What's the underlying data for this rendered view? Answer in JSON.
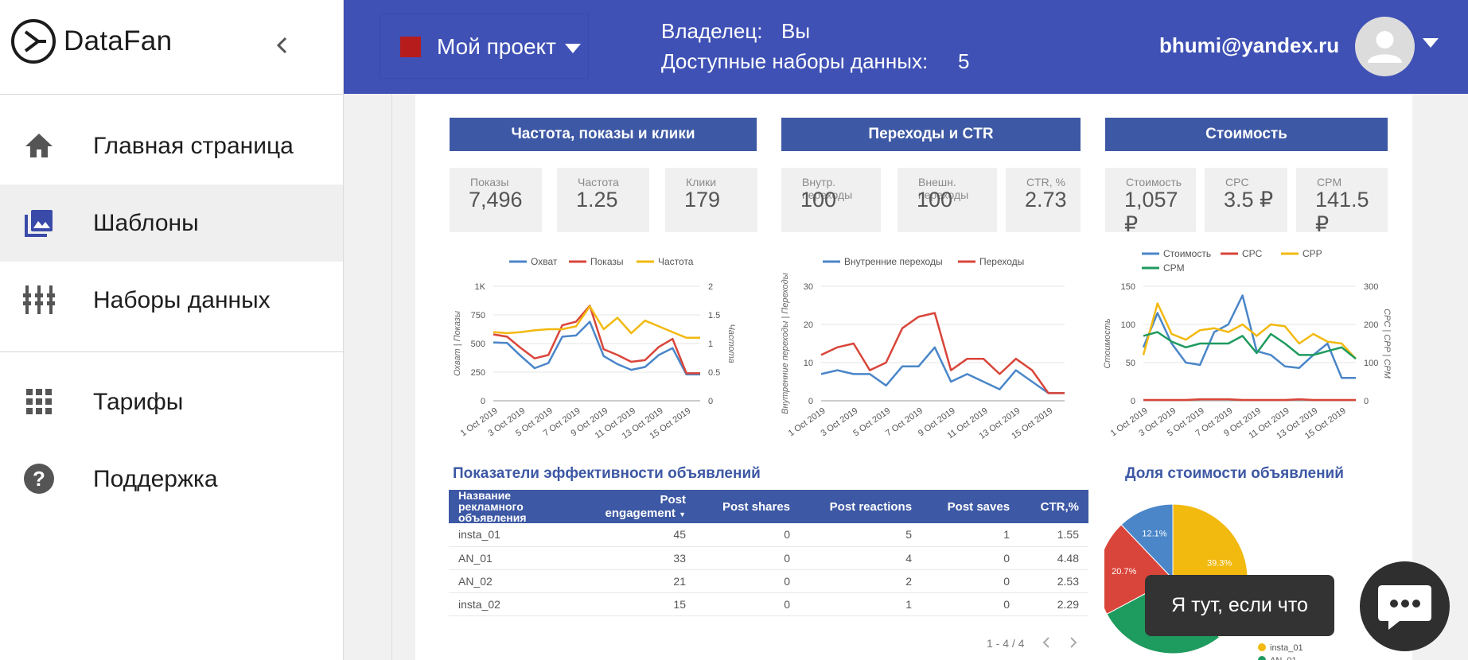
{
  "app": {
    "name": "DataFan"
  },
  "sidebar": {
    "items": [
      {
        "label": "Главная страница",
        "icon": "home-icon"
      },
      {
        "label": "Шаблоны",
        "icon": "templates-icon",
        "active": true
      },
      {
        "label": "Наборы данных",
        "icon": "datasets-icon"
      },
      {
        "label": "Тарифы",
        "icon": "grid-icon"
      },
      {
        "label": "Поддержка",
        "icon": "help-icon"
      }
    ]
  },
  "topbar": {
    "project_name": "Мой проект",
    "project_color": "#b71c1c",
    "owner_label": "Владелец:",
    "owner_value": "Вы",
    "datasets_label": "Доступные наборы данных:",
    "datasets_value": "5",
    "email": "bhumi@yandex.ru"
  },
  "colors": {
    "header": "#3f51b5",
    "accent": "#3d58a4",
    "blue": "#4a86c8",
    "red": "#d9453a",
    "yellow": "#f2b90f",
    "green": "#1e9b5e"
  },
  "sections": {
    "freq": "Частота, показы и клики",
    "clicks": "Переходы и CTR",
    "cost": "Стоимость"
  },
  "kpis": [
    {
      "label": "Показы",
      "value": "7,496"
    },
    {
      "label": "Частота",
      "value": "1.25"
    },
    {
      "label": "Клики",
      "value": "179"
    },
    {
      "label": "Внутр. переходы",
      "value": "100"
    },
    {
      "label": "Внешн. переходы",
      "value": "100"
    },
    {
      "label": "CTR, %",
      "value": "2.73"
    },
    {
      "label": "Стоимость",
      "value": "1,057 ₽"
    },
    {
      "label": "CPC",
      "value": "3.5 ₽"
    },
    {
      "label": "CPM",
      "value": "141.5 ₽"
    }
  ],
  "chart_data": [
    {
      "type": "line",
      "x": [
        "1 Oct 2019",
        "2 Oct 2019",
        "3 Oct 2019",
        "4 Oct 2019",
        "5 Oct 2019",
        "6 Oct 2019",
        "7 Oct 2019",
        "8 Oct 2019",
        "9 Oct 2019",
        "10 Oct 2019",
        "11 Oct 2019",
        "12 Oct 2019",
        "13 Oct 2019",
        "14 Oct 2019",
        "15 Oct 2019",
        "16 Oct 2019"
      ],
      "x_tick_labels": [
        "1 Oct 2019",
        "3 Oct 2019",
        "5 Oct 2019",
        "7 Oct 2019",
        "9 Oct 2019",
        "11 Oct 2019",
        "13 Oct 2019",
        "15 Oct 2019"
      ],
      "series": [
        {
          "name": "Охват",
          "axis": "left",
          "values": [
            510,
            505,
            390,
            285,
            330,
            560,
            570,
            690,
            390,
            320,
            270,
            295,
            400,
            460,
            230,
            230
          ]
        },
        {
          "name": "Показы",
          "axis": "left",
          "values": [
            580,
            560,
            460,
            370,
            400,
            660,
            690,
            830,
            450,
            400,
            340,
            355,
            470,
            540,
            240,
            240
          ]
        },
        {
          "name": "Частота",
          "axis": "right",
          "values": [
            1.2,
            1.18,
            1.2,
            1.23,
            1.25,
            1.25,
            1.3,
            1.65,
            1.25,
            1.45,
            1.18,
            1.4,
            1.3,
            1.2,
            1.1,
            1.1
          ]
        }
      ],
      "ylabel": "Охват | Показы",
      "y2label": "Частота",
      "ylim": [
        0,
        1000
      ],
      "y_ticks": [
        "0",
        "250",
        "500",
        "750",
        "1K"
      ],
      "y2lim": [
        0,
        2
      ],
      "y2_ticks": [
        "0",
        "0.5",
        "1",
        "1.5",
        "2"
      ],
      "legend": "top"
    },
    {
      "type": "line",
      "x": [
        "1 Oct 2019",
        "2 Oct 2019",
        "3 Oct 2019",
        "4 Oct 2019",
        "5 Oct 2019",
        "6 Oct 2019",
        "7 Oct 2019",
        "8 Oct 2019",
        "9 Oct 2019",
        "10 Oct 2019",
        "11 Oct 2019",
        "12 Oct 2019",
        "13 Oct 2019",
        "14 Oct 2019",
        "15 Oct 2019",
        "16 Oct 2019"
      ],
      "x_tick_labels": [
        "1 Oct 2019",
        "3 Oct 2019",
        "5 Oct 2019",
        "7 Oct 2019",
        "9 Oct 2019",
        "11 Oct 2019",
        "13 Oct 2019",
        "15 Oct 2019"
      ],
      "series": [
        {
          "name": "Внутренние переходы",
          "values": [
            7,
            8,
            7,
            7,
            4,
            9,
            9,
            14,
            5,
            7,
            5,
            3,
            8,
            5,
            2,
            2
          ]
        },
        {
          "name": "Переходы",
          "values": [
            12,
            14,
            15,
            8,
            10,
            19,
            22,
            23,
            8,
            11,
            11,
            7,
            11,
            8,
            2,
            2
          ]
        }
      ],
      "ylabel": "Внутренние переходы | Переходы",
      "ylim": [
        0,
        30
      ],
      "y_ticks": [
        "0",
        "10",
        "20",
        "30"
      ],
      "legend": "top"
    },
    {
      "type": "line",
      "x": [
        "1 Oct 2019",
        "2 Oct 2019",
        "3 Oct 2019",
        "4 Oct 2019",
        "5 Oct 2019",
        "6 Oct 2019",
        "7 Oct 2019",
        "8 Oct 2019",
        "9 Oct 2019",
        "10 Oct 2019",
        "11 Oct 2019",
        "12 Oct 2019",
        "13 Oct 2019",
        "14 Oct 2019",
        "15 Oct 2019",
        "16 Oct 2019"
      ],
      "x_tick_labels": [
        "1 Oct 2019",
        "3 Oct 2019",
        "5 Oct 2019",
        "7 Oct 2019",
        "9 Oct 2019",
        "11 Oct 2019",
        "13 Oct 2019",
        "15 Oct 2019"
      ],
      "series": [
        {
          "name": "Стоимость",
          "axis": "left",
          "values": [
            70,
            115,
            75,
            50,
            47,
            90,
            100,
            138,
            65,
            60,
            45,
            43,
            60,
            75,
            30,
            30
          ]
        },
        {
          "name": "CPC",
          "axis": "left",
          "values": [
            1,
            1,
            1,
            1,
            2,
            2,
            2,
            1,
            1,
            1,
            1,
            2,
            1,
            1,
            1,
            1
          ]
        },
        {
          "name": "CPP",
          "axis": "right",
          "values": [
            120,
            255,
            175,
            160,
            185,
            190,
            180,
            200,
            170,
            200,
            195,
            150,
            175,
            155,
            150,
            110
          ]
        },
        {
          "name": "CPM",
          "axis": "right",
          "values": [
            170,
            180,
            155,
            140,
            150,
            150,
            150,
            170,
            125,
            175,
            150,
            120,
            120,
            130,
            140,
            110
          ]
        }
      ],
      "ylabel": "Стоимость",
      "y2label": "CPC | CPP | CPM",
      "ylim": [
        0,
        150
      ],
      "y_ticks": [
        "0",
        "50",
        "100",
        "150"
      ],
      "y2lim": [
        0,
        300
      ],
      "y2_ticks": [
        "0",
        "100",
        "200",
        "300"
      ],
      "legend": "top"
    },
    {
      "type": "pie",
      "title": "Доля стоимости объявлений",
      "slices": [
        {
          "name": "insta_01",
          "value": 39.3,
          "label": "39.3%",
          "color": "#f2b90f"
        },
        {
          "name": "AN_01",
          "value": 27.9,
          "label": "",
          "color": "#1e9b5e"
        },
        {
          "name": "",
          "value": 20.7,
          "label": "20.7%",
          "color": "#d9453a"
        },
        {
          "name": "",
          "value": 12.1,
          "label": "12.1%",
          "color": "#4a86c8"
        }
      ]
    }
  ],
  "table": {
    "title": "Показатели эффективности объявлений",
    "columns": [
      "Название рекламного объявления",
      "Post engagement",
      "Post shares",
      "Post reactions",
      "Post saves",
      "CTR,%"
    ],
    "rows": [
      [
        "insta_01",
        "45",
        "0",
        "5",
        "1",
        "1.55"
      ],
      [
        "AN_01",
        "33",
        "0",
        "4",
        "0",
        "4.48"
      ],
      [
        "AN_02",
        "21",
        "0",
        "2",
        "0",
        "2.53"
      ],
      [
        "insta_02",
        "15",
        "0",
        "1",
        "0",
        "2.29"
      ]
    ],
    "pager": "1 - 4 / 4"
  },
  "chat": {
    "tooltip": "Я тут, если что"
  }
}
